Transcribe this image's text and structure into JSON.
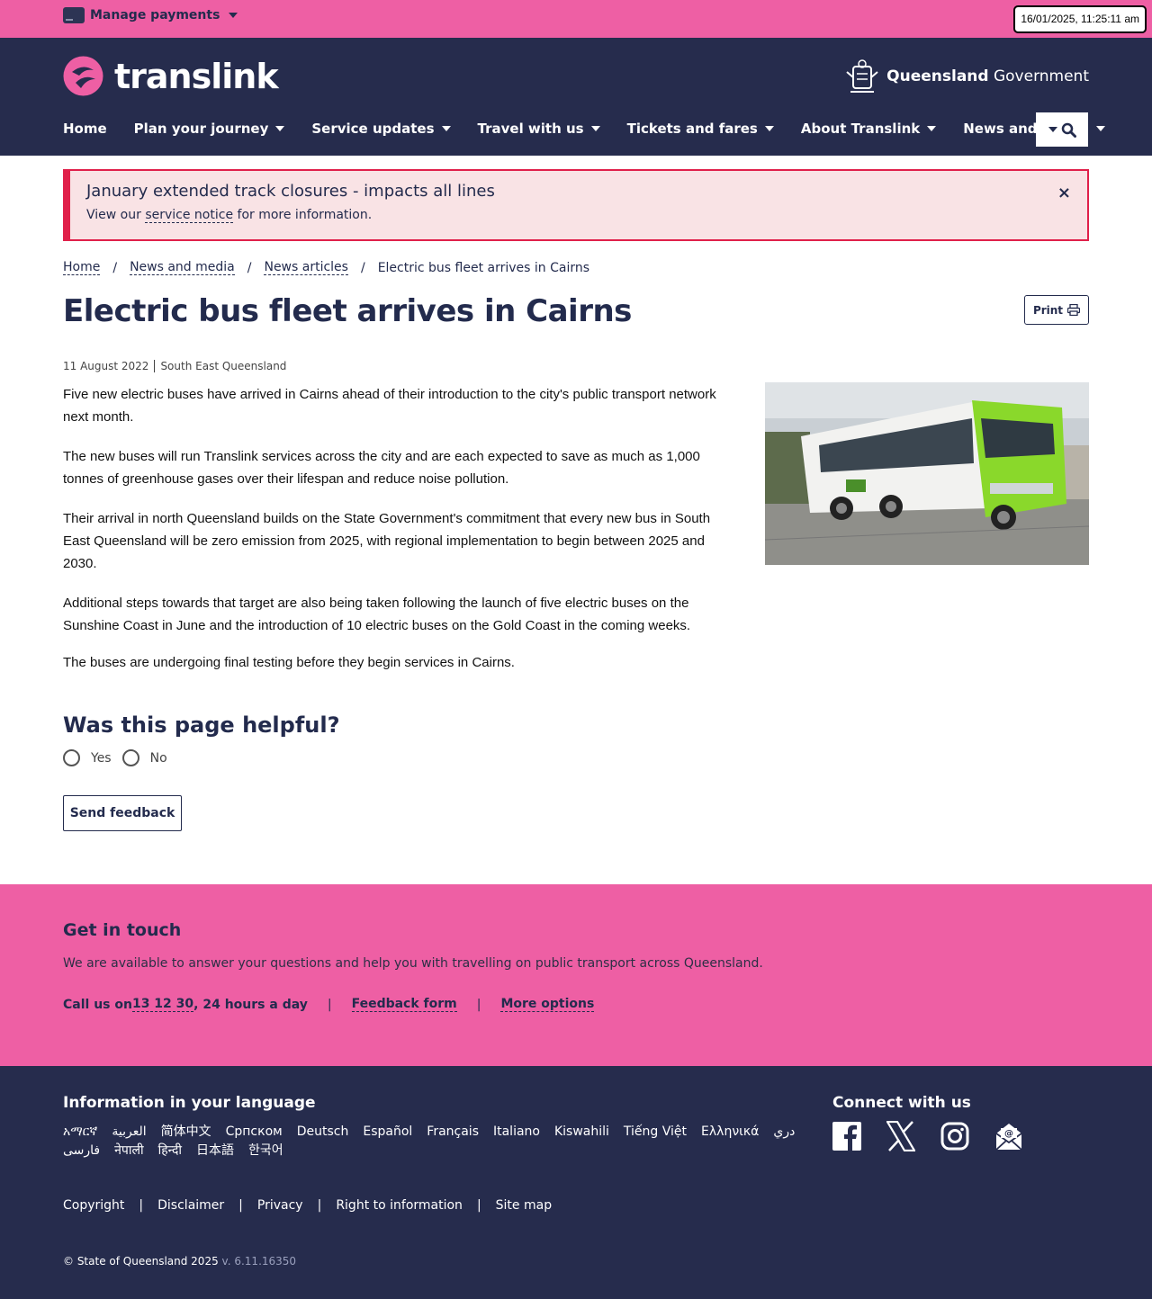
{
  "topbar": {
    "manage_label": "Manage payments",
    "datetime": "16/01/2025, 11:25:11 am"
  },
  "header": {
    "logo_text": "translink",
    "gov_bold": "Queensland",
    "gov_text": "Government",
    "nav": [
      "Home",
      "Plan your journey",
      "Service updates",
      "Travel with us",
      "Tickets and fares",
      "About Translink",
      "News and media"
    ]
  },
  "alert": {
    "title": "January extended track closures - impacts all lines",
    "body_pre": "View our ",
    "body_link": "service notice",
    "body_post": " for more information.",
    "close": "×"
  },
  "breadcrumb": {
    "items": [
      "Home",
      "News and media",
      "News articles"
    ],
    "current": "Electric bus fleet arrives in Cairns",
    "separator": "/"
  },
  "article": {
    "title": "Electric bus fleet arrives in Cairns",
    "print_label": "Print",
    "date": "11 August 2022",
    "region": "South East Queensland",
    "paragraphs": [
      "Five new electric buses have arrived in Cairns ahead of their introduction to the city's public transport network next month.",
      "The new buses will run Translink services across the city and are each expected to save as much as 1,000 tonnes of greenhouse gases over their lifespan and reduce noise pollution.",
      "Their arrival in north Queensland builds on the State Government's commitment that every new bus in South East Queensland will be zero emission from 2025, with regional implementation to begin between 2025 and 2030.",
      "Additional steps towards that target are also being taken following the launch of five electric buses on the Sunshine Coast in June and the introduction of 10 electric buses on the Gold Coast in the coming weeks.",
      "The buses are undergoing final testing before they begin services in Cairns."
    ]
  },
  "feedback": {
    "question": "Was this page helpful?",
    "yes": "Yes",
    "no": "No",
    "send": "Send feedback"
  },
  "touch": {
    "title": "Get in touch",
    "desc": "We are available to answer your questions and help you with travelling on public transport across Queensland.",
    "call_pre": "Call us on ",
    "phone": "13 12 30",
    "call_post": ", 24 hours a day",
    "feedback_form": "Feedback form",
    "more_options": "More options",
    "pipe": "|"
  },
  "footer": {
    "lang_title": "Information in your language",
    "languages": [
      "አማርኛ",
      "العربية",
      "简体中文",
      "Српском",
      "Deutsch",
      "Español",
      "Français",
      "Italiano",
      "Kiswahili",
      "Tiếng Việt",
      "Ελληνικά",
      "دري",
      "فارسی",
      "नेपाली",
      "हिन्दी",
      "日本語",
      "한국어"
    ],
    "connect_title": "Connect with us",
    "legal": [
      "Copyright",
      "Disclaimer",
      "Privacy",
      "Right to information",
      "Site map"
    ],
    "pipe": "|",
    "copyright": "© State of Queensland 2025",
    "version": "v. 6.11.16350"
  },
  "colors": {
    "brand_pink": "#ee5fa4",
    "navy": "#262c4d",
    "alert_red": "#e0204a"
  }
}
